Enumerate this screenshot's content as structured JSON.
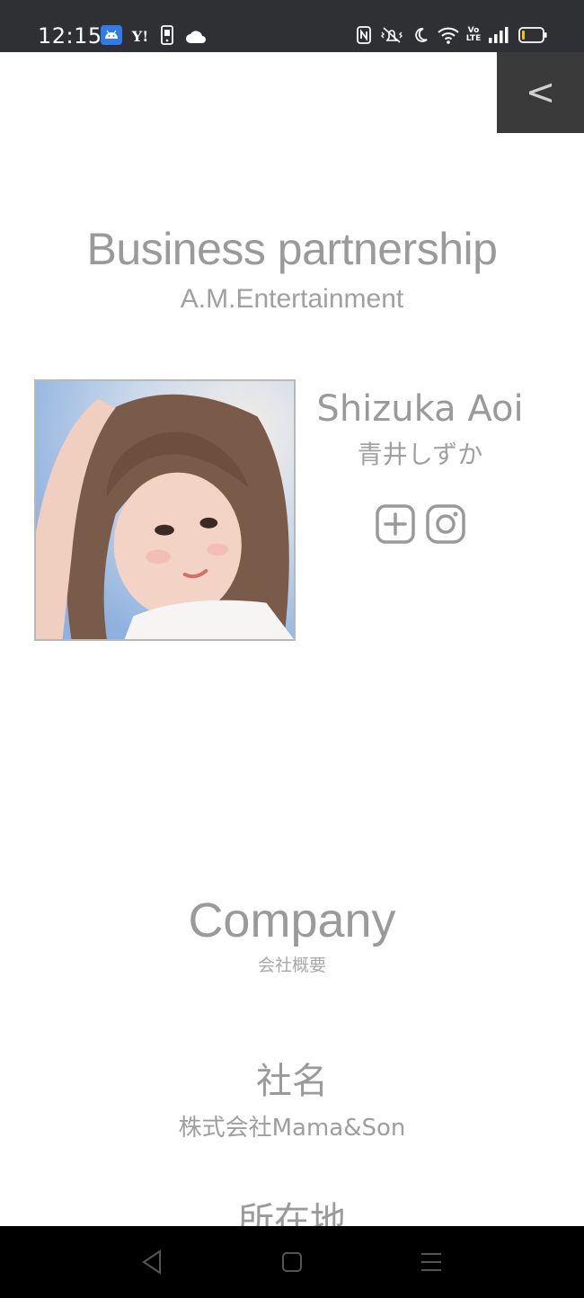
{
  "status_bar": {
    "time": "12:15",
    "left_icons": [
      "android-icon",
      "yahoo-icon",
      "phone-notification-icon",
      "cloud-icon"
    ],
    "right_icons": [
      "nfc-icon",
      "vibrate-icon",
      "moon-icon",
      "wifi-icon",
      "volte-icon",
      "signal-icon",
      "battery-icon"
    ],
    "yahoo_label": "Y!",
    "volte_label": "Vo LTE"
  },
  "header": {
    "back_label": "<"
  },
  "partnership": {
    "title": "Business partnership",
    "subtitle": "A.M.Entertainment"
  },
  "profile": {
    "name": "Shizuka Aoi",
    "name_jp": "青井しずか",
    "social": [
      "plus-square-icon",
      "instagram-icon"
    ]
  },
  "company": {
    "title": "Company",
    "subtitle": "会社概要",
    "fields": [
      {
        "label": "社名",
        "value": "株式会社Mama&Son"
      },
      {
        "label": "所在地",
        "value": ""
      }
    ]
  },
  "nav": {
    "buttons": [
      "back-triangle-icon",
      "home-square-icon",
      "menu-lines-icon"
    ]
  },
  "colors": {
    "status_bar_bg": "#2f3033",
    "back_button_bg": "#3a3a3a",
    "text_gray": "#9a9a9a",
    "nav_bg": "#000000"
  }
}
